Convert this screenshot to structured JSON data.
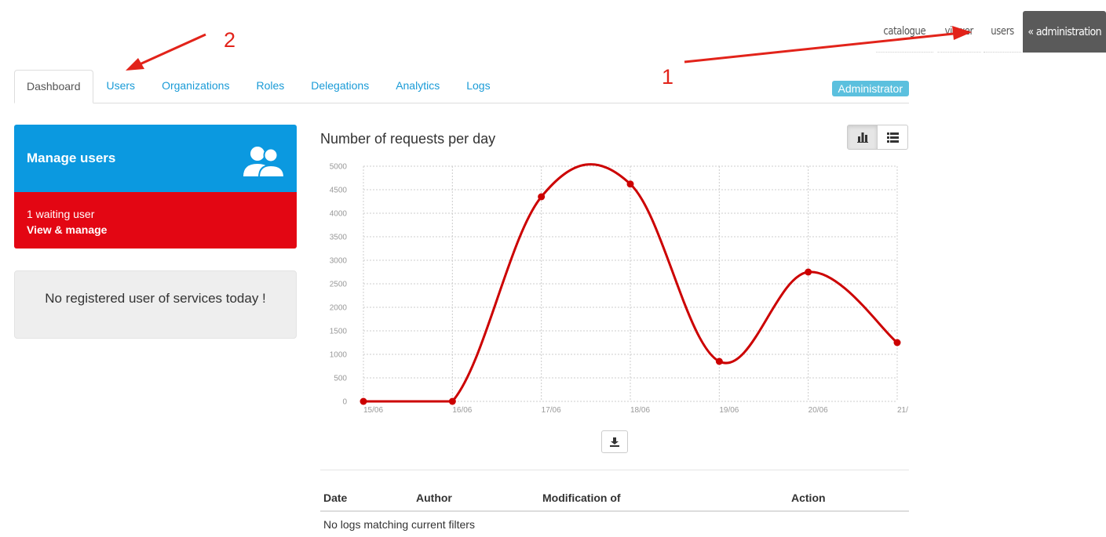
{
  "topnav": {
    "items": [
      "catalogue",
      "viewer",
      "users"
    ],
    "active": "« administration"
  },
  "annotations": {
    "one": "1",
    "two": "2"
  },
  "tabs": [
    "Dashboard",
    "Users",
    "Organizations",
    "Roles",
    "Delegations",
    "Analytics",
    "Logs"
  ],
  "role_badge": "Administrator",
  "manage_users": {
    "title": "Manage users",
    "waiting": "1 waiting user",
    "link": "View & manage",
    "icon": "users-icon"
  },
  "no_registered": "No registered user of services today !",
  "chart_title": "Number of requests per day",
  "chart_data": {
    "type": "line",
    "title": "Number of requests per day",
    "categories": [
      "15/06",
      "16/06",
      "17/06",
      "18/06",
      "19/06",
      "20/06",
      "21/"
    ],
    "values": [
      0,
      0,
      4350,
      4620,
      850,
      2750,
      1250
    ],
    "ylim": [
      0,
      5000
    ],
    "yticks": [
      0,
      500,
      1000,
      1500,
      2000,
      2500,
      3000,
      3500,
      4000,
      4500,
      5000
    ],
    "grid": true,
    "color": "#cc0000"
  },
  "logs": {
    "headers": [
      "Date",
      "Author",
      "Modification of",
      "Action"
    ],
    "empty": "No logs matching current filters"
  },
  "colors": {
    "accent": "#1a9bd7",
    "panel_blue": "#0b99e0",
    "panel_red": "#e30613",
    "annotation": "#e2231a"
  }
}
